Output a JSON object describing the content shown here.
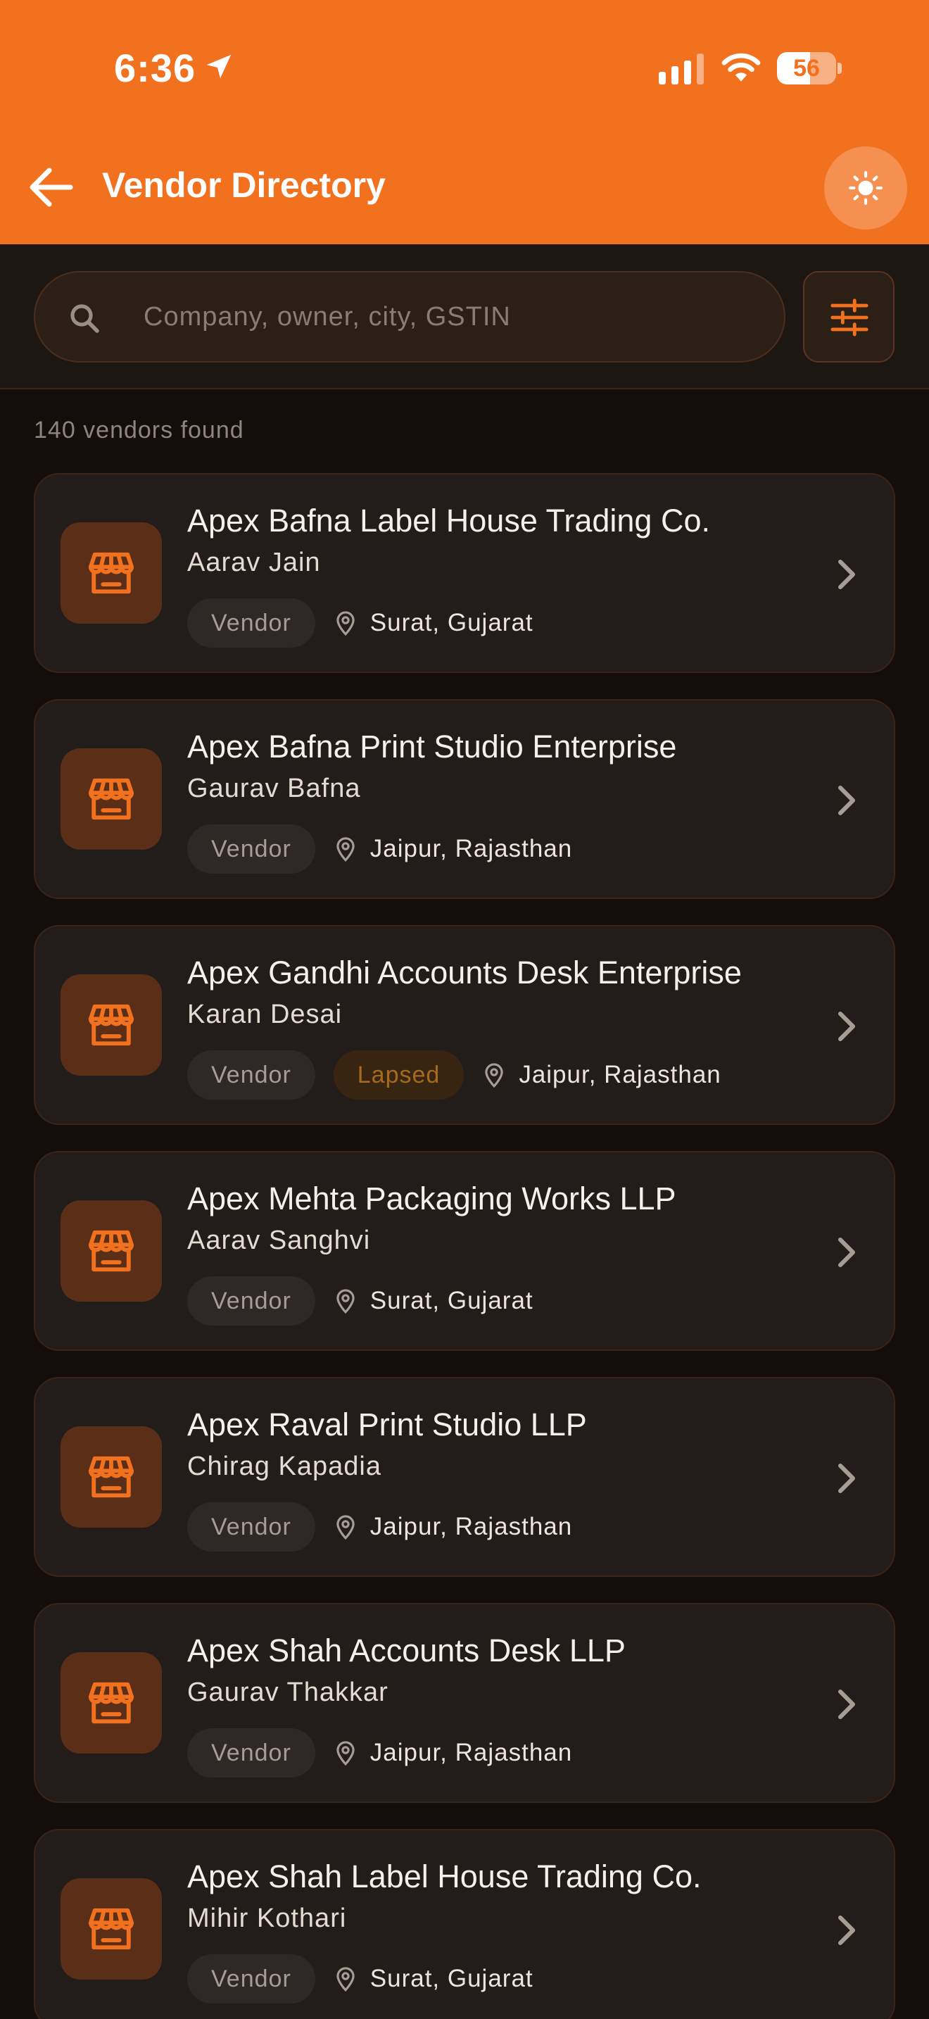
{
  "status_bar": {
    "time": "6:36",
    "battery": "56",
    "battery_level": 0.56
  },
  "header": {
    "title": "Vendor Directory"
  },
  "search": {
    "placeholder": "Company, owner, city, GSTIN",
    "value": ""
  },
  "results": {
    "count_text": "140 vendors found"
  },
  "colors": {
    "accent": "#f2711f",
    "background": "#130e0b",
    "card": "#221c1a",
    "icon_bg": "#5a2e17",
    "lapsed": "#a66a1c"
  },
  "icons": {
    "back": "arrow-left-icon",
    "theme": "sun-icon",
    "search": "search-icon",
    "filter": "sliders-icon",
    "vendor": "storefront-icon",
    "location": "map-pin-icon",
    "open": "chevron-right-icon"
  },
  "vendors": [
    {
      "company": "Apex Bafna Label House Trading Co.",
      "owner": "Aarav Jain",
      "type": "Vendor",
      "status": "",
      "location": "Surat, Gujarat"
    },
    {
      "company": "Apex Bafna Print Studio Enterprise",
      "owner": "Gaurav Bafna",
      "type": "Vendor",
      "status": "",
      "location": "Jaipur, Rajasthan"
    },
    {
      "company": "Apex Gandhi Accounts Desk Enterprise",
      "owner": "Karan Desai",
      "type": "Vendor",
      "status": "Lapsed",
      "location": "Jaipur, Rajasthan"
    },
    {
      "company": "Apex Mehta Packaging Works LLP",
      "owner": "Aarav Sanghvi",
      "type": "Vendor",
      "status": "",
      "location": "Surat, Gujarat"
    },
    {
      "company": "Apex Raval Print Studio LLP",
      "owner": "Chirag Kapadia",
      "type": "Vendor",
      "status": "",
      "location": "Jaipur, Rajasthan"
    },
    {
      "company": "Apex Shah Accounts Desk LLP",
      "owner": "Gaurav Thakkar",
      "type": "Vendor",
      "status": "",
      "location": "Jaipur, Rajasthan"
    },
    {
      "company": "Apex Shah Label House Trading Co.",
      "owner": "Mihir Kothari",
      "type": "Vendor",
      "status": "",
      "location": "Surat, Gujarat"
    }
  ]
}
